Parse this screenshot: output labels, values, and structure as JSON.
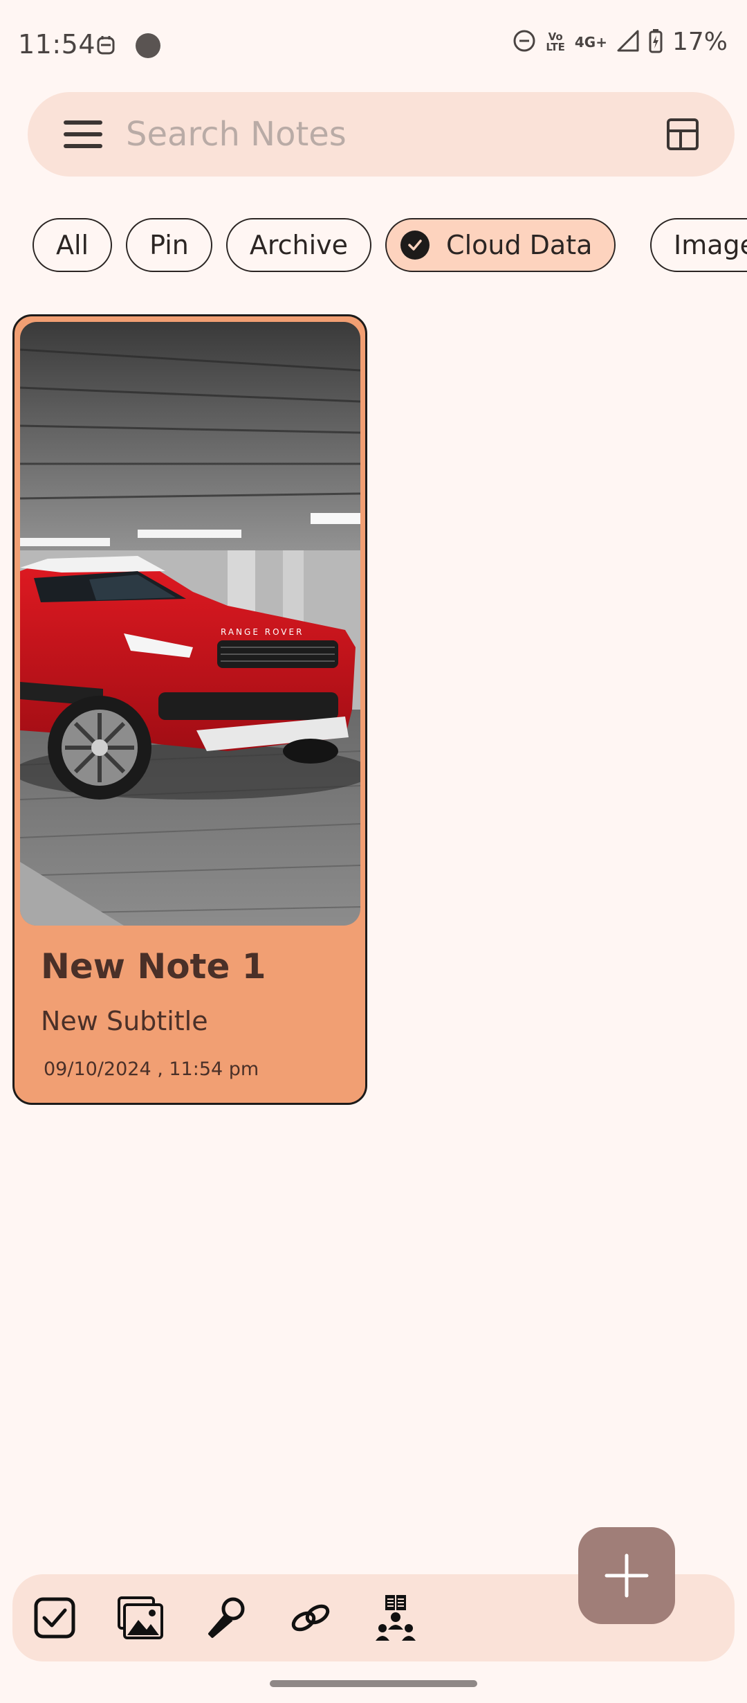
{
  "status_bar": {
    "time": "11:54",
    "network": "4G+",
    "volte_line1": "Vo",
    "volte_line2": "LTE",
    "battery": "17%"
  },
  "search": {
    "placeholder": "Search Notes"
  },
  "filters": [
    {
      "label": "All",
      "selected": false
    },
    {
      "label": "Pin",
      "selected": false
    },
    {
      "label": "Archive",
      "selected": false
    },
    {
      "label": "Cloud Data",
      "selected": true
    },
    {
      "label": "Image",
      "selected": false
    }
  ],
  "note": {
    "title": "New Note 1",
    "subtitle": "New Subtitle",
    "date": "09/10/2024 , 11:54 pm",
    "image_icon": "red-suv-photo",
    "image_brand_text": "RANGE ROVER"
  },
  "toolbar": {
    "tools": [
      "checkbox-icon",
      "image-gallery-icon",
      "microphone-icon",
      "link-icon",
      "reading-group-icon"
    ],
    "fab_icon": "plus-icon"
  },
  "colors": {
    "background": "#fff6f3",
    "search_bar": "#fae2d8",
    "selected_chip": "#fdd3be",
    "note_card": "#f19f73",
    "fab": "#a07e78"
  }
}
